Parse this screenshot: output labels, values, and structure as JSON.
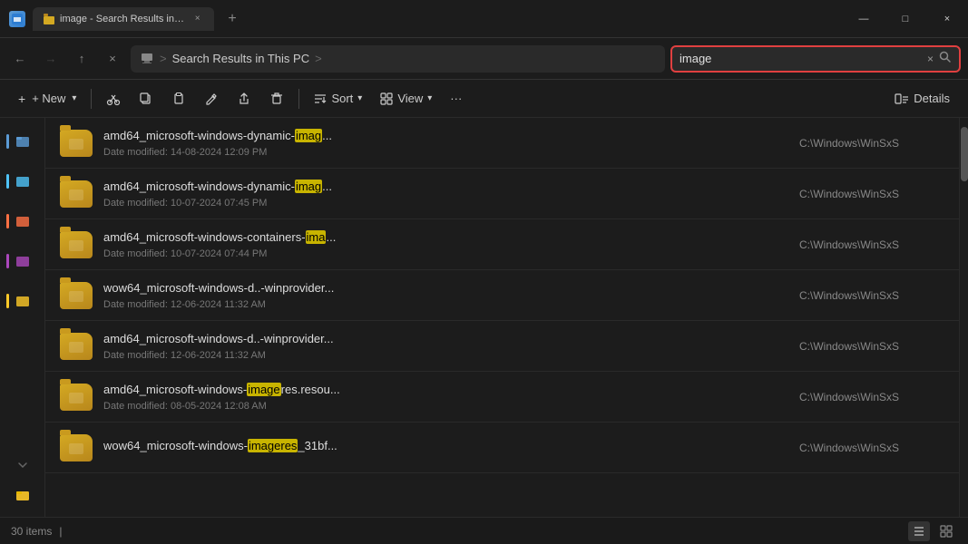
{
  "titlebar": {
    "icon": "📁",
    "tab_label": "image - Search Results in This |",
    "close_tab": "×",
    "new_tab": "+",
    "minimize": "—",
    "maximize": "□",
    "close_window": "×"
  },
  "addressbar": {
    "nav_back": "←",
    "nav_forward": "→",
    "nav_up": "↑",
    "nav_cancel": "×",
    "pc_icon": "🖥",
    "path_sep1": ">",
    "path_label": "Search Results in This PC",
    "path_sep2": ">",
    "search_value": "image",
    "search_clear": "×",
    "search_go": "🔍"
  },
  "toolbar": {
    "new_label": "+ New",
    "new_arrow": "∨",
    "cut_icon": "✂",
    "copy_icon": "⧉",
    "paste_icon": "📋",
    "rename_icon": "A",
    "share_icon": "↗",
    "delete_icon": "🗑",
    "sort_label": "Sort",
    "sort_icon": "↕",
    "view_label": "View",
    "view_icon": "⊞",
    "more_icon": "···",
    "details_label": "Details",
    "details_icon": "⊡"
  },
  "sidebar_colors": [
    "#5b9bd5",
    "#4fc3f7",
    "#ff7043",
    "#ab47bc",
    "#ffca28"
  ],
  "files": [
    {
      "name_prefix": "amd64_microsoft-windows-dynamic-",
      "name_highlight": "imag",
      "name_suffix": "...",
      "date": "Date modified: 14-08-2024 12:09 PM",
      "path": "C:\\Windows\\WinSxS"
    },
    {
      "name_prefix": "amd64_microsoft-windows-dynamic-",
      "name_highlight": "imag",
      "name_suffix": "...",
      "date": "Date modified: 10-07-2024 07:45 PM",
      "path": "C:\\Windows\\WinSxS"
    },
    {
      "name_prefix": "amd64_microsoft-windows-containers-",
      "name_highlight": "ima",
      "name_suffix": "...",
      "date": "Date modified: 10-07-2024 07:44 PM",
      "path": "C:\\Windows\\WinSxS"
    },
    {
      "name_prefix": "wow64_microsoft-windows-d..-winprovider",
      "name_highlight": "",
      "name_suffix": "...",
      "date": "Date modified: 12-06-2024 11:32 AM",
      "path": "C:\\Windows\\WinSxS"
    },
    {
      "name_prefix": "amd64_microsoft-windows-d..-winprovider",
      "name_highlight": "",
      "name_suffix": "...",
      "date": "Date modified: 12-06-2024 11:32 AM",
      "path": "C:\\Windows\\WinSxS"
    },
    {
      "name_prefix": "amd64_microsoft-windows-",
      "name_highlight": "image",
      "name_suffix": "res.resou...",
      "date": "Date modified: 08-05-2024 12:08 AM",
      "path": "C:\\Windows\\WinSxS"
    },
    {
      "name_prefix": "wow64_microsoft-windows-",
      "name_highlight": "imageres",
      "name_suffix": "_31bf...",
      "date": "",
      "path": "C:\\Windows\\WinSxS"
    }
  ],
  "statusbar": {
    "count": "30 items",
    "separator": "|",
    "list_view_icon": "☰",
    "grid_view_icon": "⊞"
  }
}
